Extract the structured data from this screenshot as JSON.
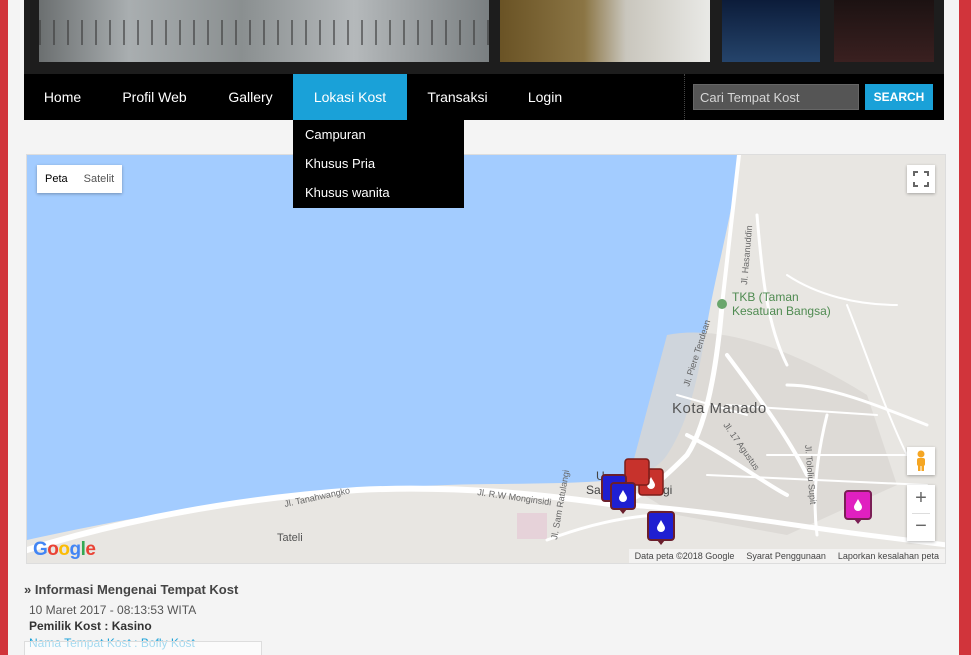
{
  "nav": {
    "items": [
      {
        "label": "Home"
      },
      {
        "label": "Profil Web"
      },
      {
        "label": "Gallery"
      },
      {
        "label": "Lokasi Kost"
      },
      {
        "label": "Transaksi"
      },
      {
        "label": "Login"
      }
    ],
    "active": "Lokasi Kost"
  },
  "search": {
    "placeholder": "Cari Tempat Kost",
    "value": "",
    "button_label": "SEARCH"
  },
  "dropdown": {
    "items": [
      {
        "label": "Campuran"
      },
      {
        "label": "Khusus Pria"
      },
      {
        "label": "Khusus wanita"
      }
    ]
  },
  "map": {
    "type_peta": "Peta",
    "type_satelit": "Satelit",
    "selected_type": "Peta",
    "labels": {
      "city": "Kota Manado",
      "poi_line1": "TKB (Taman",
      "poi_line2": "Kesatuan Bangsa)",
      "tateli": "Tateli",
      "road_tanahwangko": "Jl. Tanahwangko",
      "road_monginsidi": "Jl. R.W Monginsidi",
      "road_piere": "Jl. Piere Tendean",
      "road_agustus": "Jl. 17 Agustus",
      "road_tololiu": "Jl. Tololiu Supit",
      "road_sam": "Jl. Sam Ratulangi",
      "road_hasanuddin": "Jl. Hasanuddin",
      "town_partial_1": "U",
      "town_partial_2": "Sa",
      "town_partial_3": "gi"
    },
    "google_logo": "Google",
    "attribution": {
      "data": "Data peta ©2018 Google",
      "terms": "Syarat Penggunaan",
      "report": "Laporkan kesalahan peta"
    },
    "zoom_in": "+",
    "zoom_out": "−",
    "marker_colors": {
      "campuran": "#1f1fd1",
      "pria": "#c7322c",
      "wanita": "#e020c0"
    },
    "water_color": "#a3ccff",
    "land_color": "#e8e6e2"
  },
  "info": {
    "title": "» Informasi Mengenai Tempat Kost",
    "date": "10 Maret 2017 - 08:13:53 WITA",
    "owner": "Pemilik Kost : Kasino",
    "name_partial": "Nama Tempat Kost : Bofly Kost"
  },
  "colors": {
    "accent": "#1aa1d8",
    "stripe": "#d1343b",
    "nav_bg": "#000000"
  }
}
